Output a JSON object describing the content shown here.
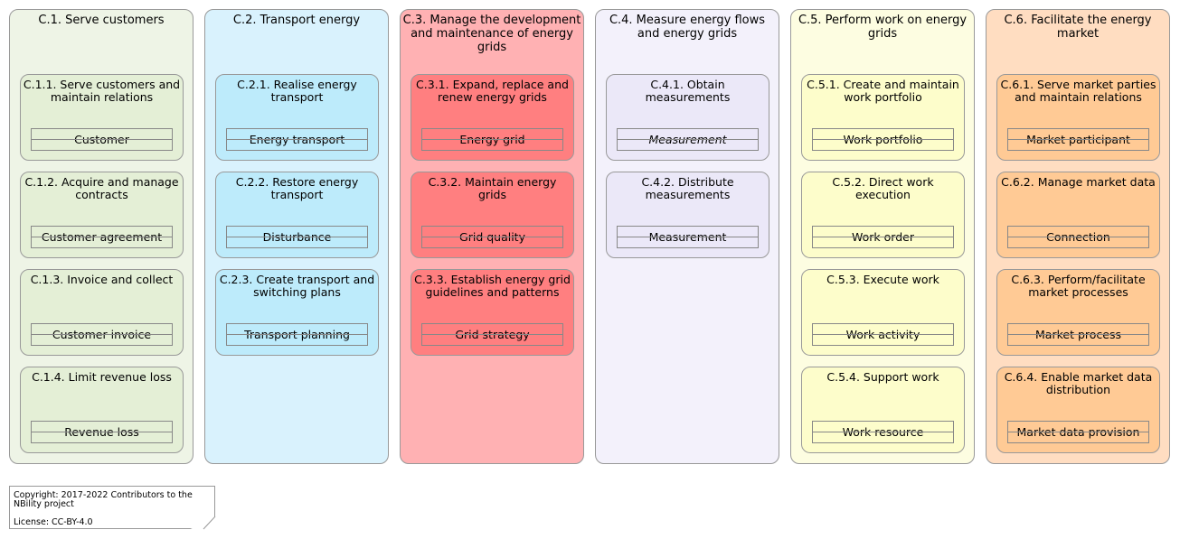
{
  "columns": [
    {
      "title": "C.1. Serve customers",
      "bg": "#EEF4E6",
      "cap_bg": "#E4EFD6",
      "capabilities": [
        {
          "title": "C.1.1. Serve customers and maintain relations",
          "entity": "Customer"
        },
        {
          "title": "C.1.2. Acquire and manage contracts",
          "entity": "Customer agreement"
        },
        {
          "title": "C.1.3. Invoice and collect",
          "entity": "Customer invoice"
        },
        {
          "title": "C.1.4. Limit revenue loss",
          "entity": "Revenue loss"
        }
      ]
    },
    {
      "title": "C.2. Transport energy",
      "bg": "#D9F2FD",
      "cap_bg": "#BDEBFB",
      "capabilities": [
        {
          "title": "C.2.1. Realise energy transport",
          "entity": "Energy transport"
        },
        {
          "title": "C.2.2. Restore energy transport",
          "entity": "Disturbance"
        },
        {
          "title": "C.2.3. Create transport and switching plans",
          "entity": "Transport planning"
        }
      ]
    },
    {
      "title": "C.3. Manage the development and maintenance of energy grids",
      "bg": "#FFB1B3",
      "cap_bg": "#FF7F80",
      "capabilities": [
        {
          "title": "C.3.1. Expand, replace and renew energy grids",
          "entity": "Energy grid"
        },
        {
          "title": "C.3.2. Maintain energy grids",
          "entity": "Grid quality"
        },
        {
          "title": "C.3.3. Establish energy grid guidelines and patterns",
          "entity": "Grid strategy"
        }
      ]
    },
    {
      "title": "C.4. Measure energy flows and energy grids",
      "bg": "#F3F1FB",
      "cap_bg": "#EBE8F8",
      "capabilities": [
        {
          "title": "C.4.1. Obtain measurements",
          "entity": "Measurement",
          "italic": true
        },
        {
          "title": "C.4.2. Distribute measurements",
          "entity": "Measurement"
        }
      ]
    },
    {
      "title": "C.5. Perform work on energy grids",
      "bg": "#FDFDE1",
      "cap_bg": "#FDFDCB",
      "capabilities": [
        {
          "title": "C.5.1. Create and maintain work portfolio",
          "entity": "Work portfolio"
        },
        {
          "title": "C.5.2. Direct work execution",
          "entity": "Work order"
        },
        {
          "title": "C.5.3. Execute work",
          "entity": "Work activity"
        },
        {
          "title": "C.5.4. Support work",
          "entity": "Work resource"
        }
      ]
    },
    {
      "title": "C.6. Facilitate the energy market",
      "bg": "#FFDDC1",
      "cap_bg": "#FFCA95",
      "capabilities": [
        {
          "title": "C.6.1. Serve market parties and maintain relations",
          "entity": "Market participant"
        },
        {
          "title": "C.6.2. Manage market data",
          "entity": "Connection"
        },
        {
          "title": "C.6.3. Perform/facilitate market processes",
          "entity": "Market process"
        },
        {
          "title": "C.6.4. Enable market data distribution",
          "entity": "Market data provision"
        }
      ]
    }
  ],
  "note": {
    "copyright": "Copyright: 2017-2022 Contributors to the NBility project",
    "license": "License: CC-BY-4.0"
  }
}
